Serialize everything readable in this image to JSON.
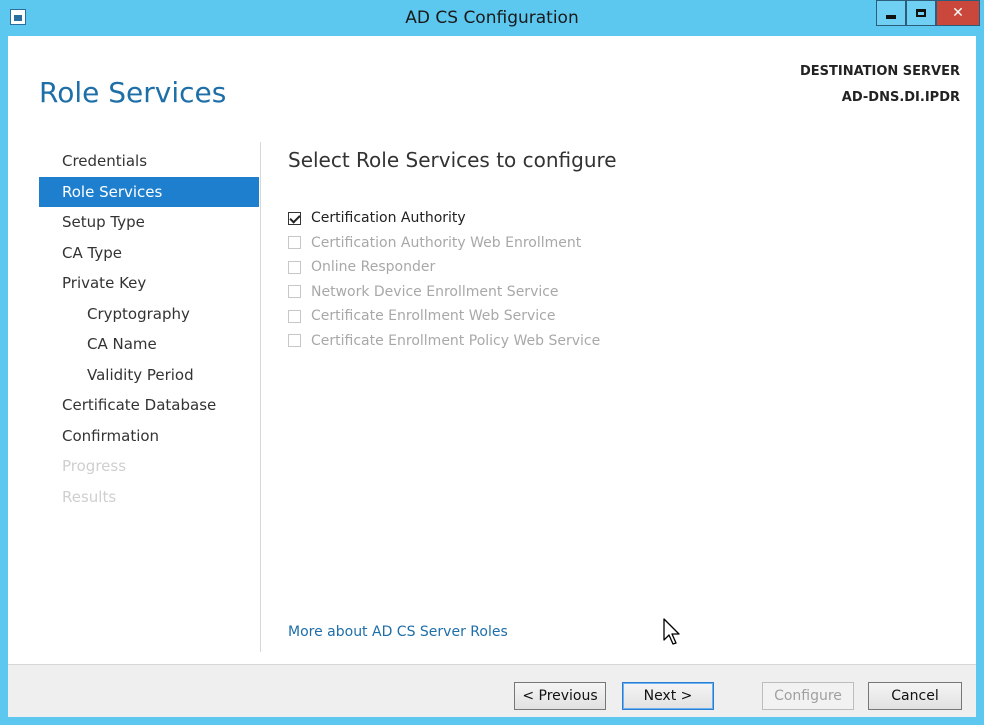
{
  "window": {
    "title": "AD CS Configuration"
  },
  "header": {
    "page_title": "Role Services",
    "destination_label": "DESTINATION SERVER",
    "destination_value": "AD-DNS.DI.IPDR"
  },
  "nav": {
    "items": [
      {
        "label": "Credentials",
        "state": "normal"
      },
      {
        "label": "Role Services",
        "state": "selected"
      },
      {
        "label": "Setup Type",
        "state": "normal"
      },
      {
        "label": "CA Type",
        "state": "normal"
      },
      {
        "label": "Private Key",
        "state": "normal"
      },
      {
        "label": "Cryptography",
        "state": "sub"
      },
      {
        "label": "CA Name",
        "state": "sub"
      },
      {
        "label": "Validity Period",
        "state": "sub"
      },
      {
        "label": "Certificate Database",
        "state": "normal"
      },
      {
        "label": "Confirmation",
        "state": "normal"
      },
      {
        "label": "Progress",
        "state": "disabled"
      },
      {
        "label": "Results",
        "state": "disabled"
      }
    ]
  },
  "main": {
    "section_title": "Select Role Services to configure",
    "options": [
      {
        "label": "Certification Authority",
        "checked": true,
        "enabled": true
      },
      {
        "label": "Certification Authority Web Enrollment",
        "checked": false,
        "enabled": false
      },
      {
        "label": "Online Responder",
        "checked": false,
        "enabled": false
      },
      {
        "label": "Network Device Enrollment Service",
        "checked": false,
        "enabled": false
      },
      {
        "label": "Certificate Enrollment Web Service",
        "checked": false,
        "enabled": false
      },
      {
        "label": "Certificate Enrollment Policy Web Service",
        "checked": false,
        "enabled": false
      }
    ],
    "more_link": "More about AD CS Server Roles"
  },
  "footer": {
    "previous_label": "< Previous",
    "next_label": "Next >",
    "configure_label": "Configure",
    "cancel_label": "Cancel"
  },
  "colors": {
    "accent": "#1f7fcf",
    "title_blue": "#1e6ea8",
    "titlebar": "#5cc8f0",
    "close_red": "#c9483b"
  }
}
